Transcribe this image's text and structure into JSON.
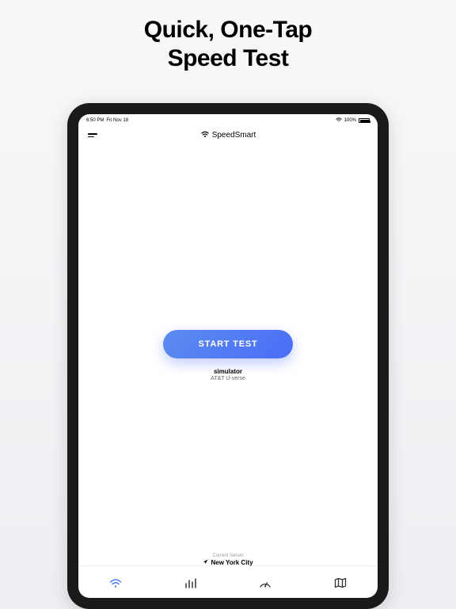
{
  "marketing": {
    "title_line1": "Quick, One-Tap",
    "title_line2": "Speed Test"
  },
  "status_bar": {
    "time": "6:50 PM",
    "date": "Fri Nov 18",
    "battery_percent": "100%"
  },
  "header": {
    "app_name": "SpeedSmart"
  },
  "main": {
    "start_button_label": "START TEST",
    "network_name": "simulator",
    "network_isp": "AT&T U-verse"
  },
  "server": {
    "label": "Current Server",
    "name": "New York City"
  },
  "tabs": {
    "speed": "wifi",
    "history": "bars",
    "tools": "gauge",
    "map": "map"
  },
  "colors": {
    "accent": "#4a6cf7",
    "button_gradient_start": "#5b8def",
    "button_gradient_end": "#4a6cf7"
  }
}
